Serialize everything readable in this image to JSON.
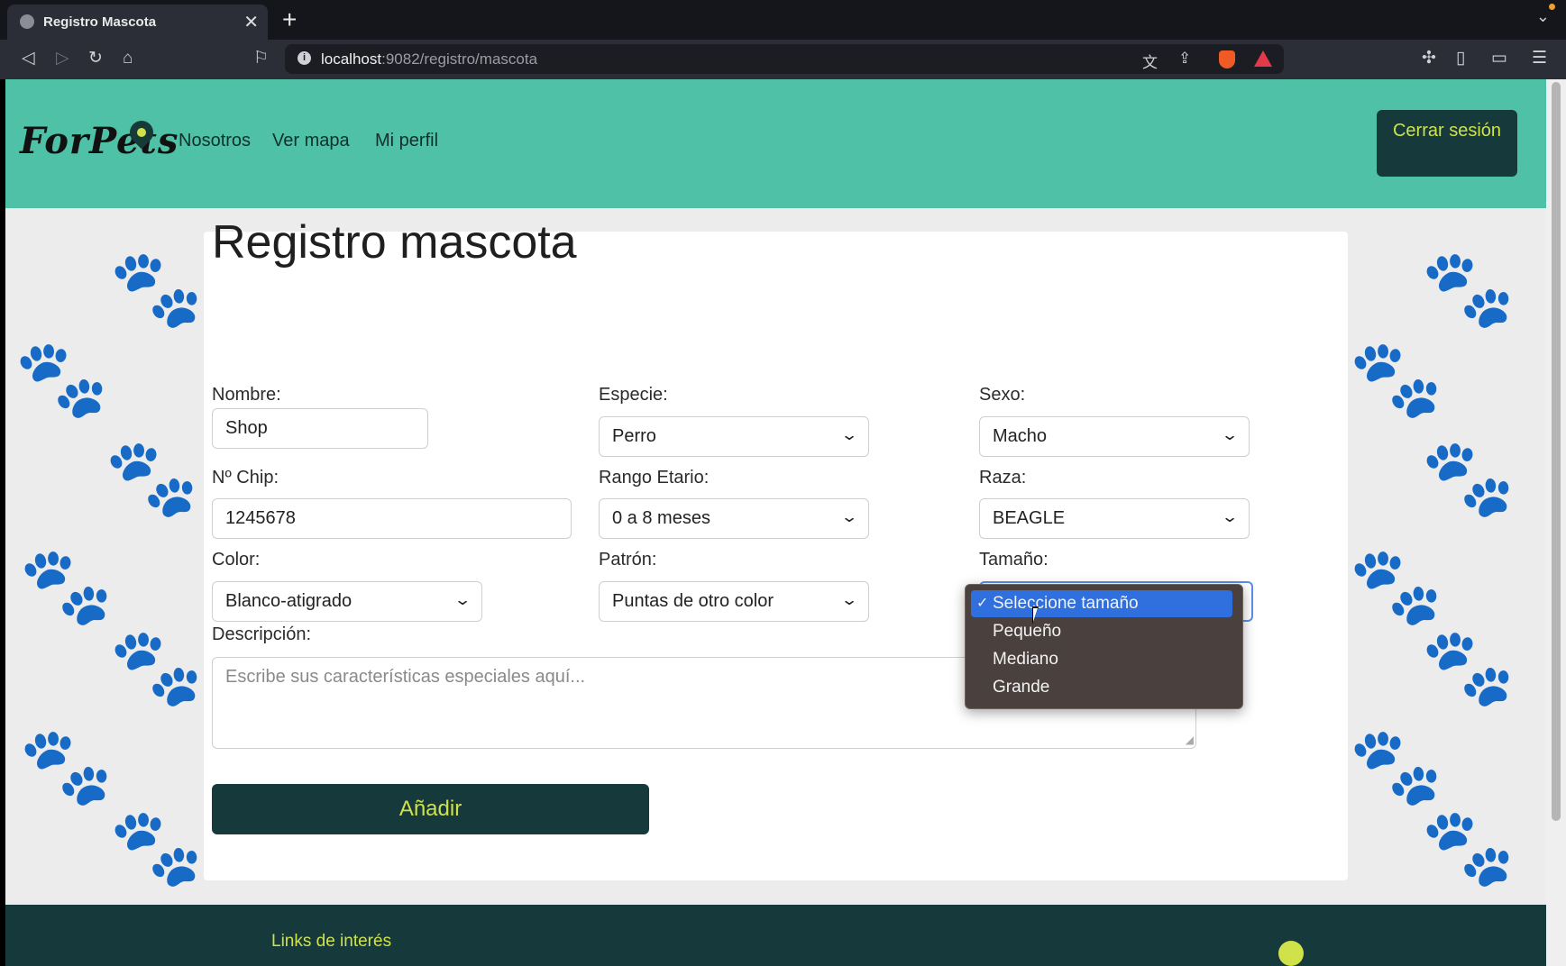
{
  "browser": {
    "tab_title": "Registro Mascota",
    "tab_close": "✕",
    "new_tab": "+",
    "url_host": "localhost",
    "url_path": ":9082/registro/mascota"
  },
  "header": {
    "logo": "ForPets",
    "nav": [
      "Nosotros",
      "Ver mapa",
      "Mi perfil"
    ],
    "logout_label": "Cerrar sesión"
  },
  "form": {
    "title": "Registro mascota",
    "nombre": {
      "label": "Nombre:",
      "value": "Shop"
    },
    "especie": {
      "label": "Especie:",
      "value": "Perro"
    },
    "sexo": {
      "label": "Sexo:",
      "value": "Macho"
    },
    "chip": {
      "label": "Nº Chip:",
      "value": "1245678"
    },
    "rango": {
      "label": "Rango Etario:",
      "value": "0 a 8 meses"
    },
    "raza": {
      "label": "Raza:",
      "value": "BEAGLE"
    },
    "color": {
      "label": "Color:",
      "value": "Blanco-atigrado"
    },
    "patron": {
      "label": "Patrón:",
      "value": "Puntas de otro color"
    },
    "tamano": {
      "label": "Tamaño:",
      "options": [
        "Seleccione tamaño",
        "Pequeño",
        "Mediano",
        "Grande"
      ],
      "selected": "Seleccione tamaño"
    },
    "descripcion": {
      "label": "Descripción:",
      "placeholder": "Escribe sus características especiales aquí..."
    },
    "submit_label": "Añadir"
  },
  "footer": {
    "links_title": "Links de interés"
  },
  "colors": {
    "header_bg": "#4fc1a6",
    "dark": "#16393b",
    "accent": "#cfe24a",
    "selection": "#2f6fde"
  }
}
